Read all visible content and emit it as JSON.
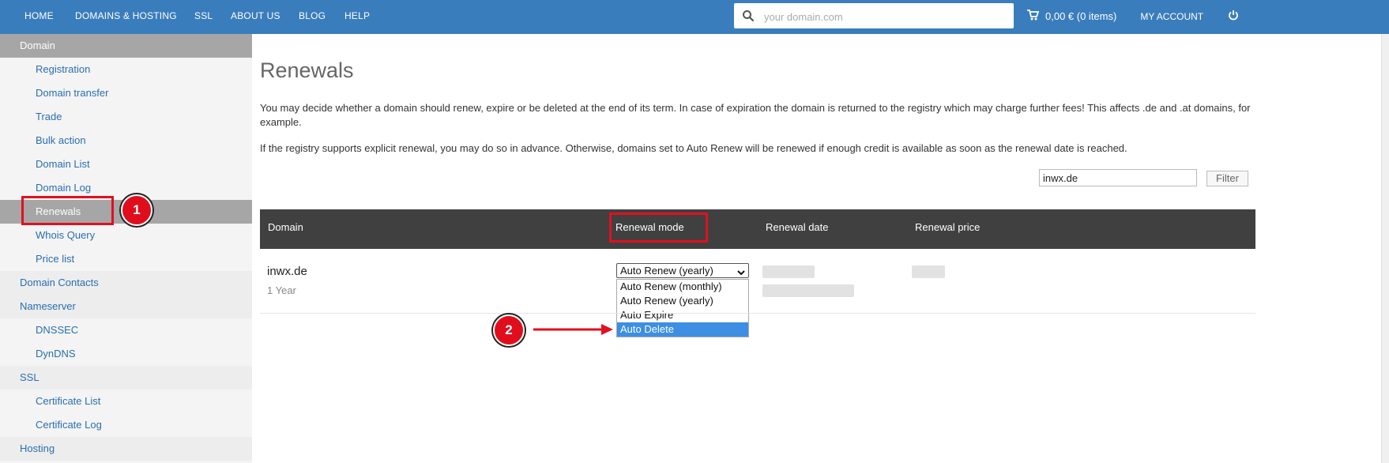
{
  "nav": {
    "items": [
      "HOME",
      "DOMAINS & HOSTING",
      "SSL",
      "ABOUT US",
      "BLOG",
      "HELP"
    ],
    "search_placeholder": "your domain.com",
    "cart": "0,00 € (0 items)",
    "account": "MY ACCOUNT",
    "icons": [
      "search-icon",
      "cart-icon",
      "power-icon"
    ]
  },
  "sidebar": {
    "items": [
      {
        "label": "Domain",
        "kind": "header"
      },
      {
        "label": "Registration",
        "kind": "sub"
      },
      {
        "label": "Domain transfer",
        "kind": "sub"
      },
      {
        "label": "Trade",
        "kind": "sub"
      },
      {
        "label": "Bulk action",
        "kind": "sub"
      },
      {
        "label": "Domain List",
        "kind": "sub"
      },
      {
        "label": "Domain Log",
        "kind": "sub"
      },
      {
        "label": "Renewals",
        "kind": "active"
      },
      {
        "label": "Whois Query",
        "kind": "sub"
      },
      {
        "label": "Price list",
        "kind": "sub"
      },
      {
        "label": "Domain Contacts",
        "kind": "section"
      },
      {
        "label": "Nameserver",
        "kind": "section"
      },
      {
        "label": "DNSSEC",
        "kind": "sub"
      },
      {
        "label": "DynDNS",
        "kind": "sub"
      },
      {
        "label": "SSL",
        "kind": "section"
      },
      {
        "label": "Certificate List",
        "kind": "sub"
      },
      {
        "label": "Certificate Log",
        "kind": "sub"
      },
      {
        "label": "Hosting",
        "kind": "section"
      }
    ]
  },
  "main": {
    "title": "Renewals",
    "paragraph1": "You may decide whether a domain should renew, expire or be deleted at the end of its term. In case of expiration the domain is returned to the registry which may charge further fees! This affects .de and .at domains, for example.",
    "paragraph2": "If the registry supports explicit renewal, you may do so in advance. Otherwise, domains set to Auto Renew will be renewed if enough credit is available as soon as the renewal date is reached.",
    "filter_value": "inwx.de",
    "filter_button": "Filter"
  },
  "table": {
    "headers": [
      "Domain",
      "Renewal mode",
      "Renewal date",
      "Renewal price"
    ],
    "rows": [
      {
        "domain": "inwx.de",
        "term": "1 Year",
        "mode": "Auto Renew (yearly)"
      }
    ],
    "mode_options": [
      "Auto Renew (monthly)",
      "Auto Renew (yearly)",
      "Auto Expire",
      "Auto Delete"
    ],
    "highlighted_option": "Auto Delete"
  },
  "annotations": {
    "badges": [
      "1",
      "2"
    ],
    "color": "#e0101e"
  },
  "colors": {
    "nav_bg": "#3a7dbd",
    "link": "#2a6eb0",
    "active_bg": "#a6a6a6",
    "table_head": "#404040",
    "option_highlight": "#3c8fe3"
  }
}
